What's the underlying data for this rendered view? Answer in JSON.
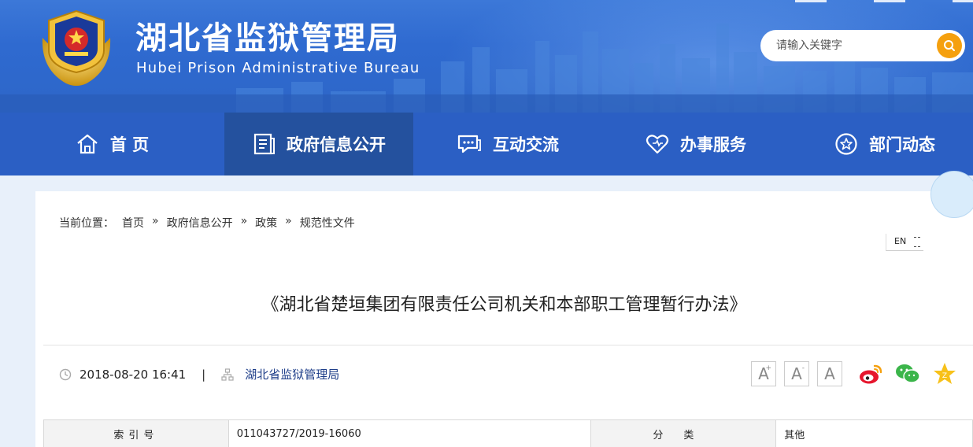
{
  "header": {
    "title": "湖北省监狱管理局",
    "subtitle": "Hubei Prison Administrative Bureau",
    "emblem_icon": "police-emblem-icon",
    "search": {
      "placeholder": "请输入关键字",
      "icon": "search-icon",
      "button_color": "#f5a00e"
    }
  },
  "nav": {
    "items": [
      {
        "label": "首 页",
        "icon": "home-icon"
      },
      {
        "label": "政府信息公开",
        "icon": "document-icon",
        "active": true
      },
      {
        "label": "互动交流",
        "icon": "chat-icon"
      },
      {
        "label": "办事服务",
        "icon": "heart-icon"
      },
      {
        "label": "部门动态",
        "icon": "star-icon"
      }
    ]
  },
  "breadcrumb": {
    "prefix": "当前位置：",
    "items": [
      "首页",
      "政府信息公开",
      "政策",
      "规范性文件"
    ],
    "separator": "»"
  },
  "lang_toggle": {
    "label": "EN"
  },
  "article": {
    "title": "《湖北省楚垣集团有限责任公司机关和本部职工管理暂行办法》",
    "date": "2018-08-20 16:41",
    "separator": "|",
    "source": "湖北省监狱管理局",
    "font_controls": [
      "A",
      "A",
      "A"
    ],
    "share": [
      "weibo-icon",
      "wechat-icon",
      "favorite-star-icon"
    ]
  },
  "info_table": {
    "row1": {
      "label1": "索引号",
      "value1": "011043727/2019-16060",
      "label2": "分类",
      "value2": "其他"
    }
  },
  "colors": {
    "header_blue": "#2f6ad0",
    "nav_blue": "#2b5fc4",
    "nav_active": "#24519e",
    "accent_orange": "#f5a00e"
  }
}
